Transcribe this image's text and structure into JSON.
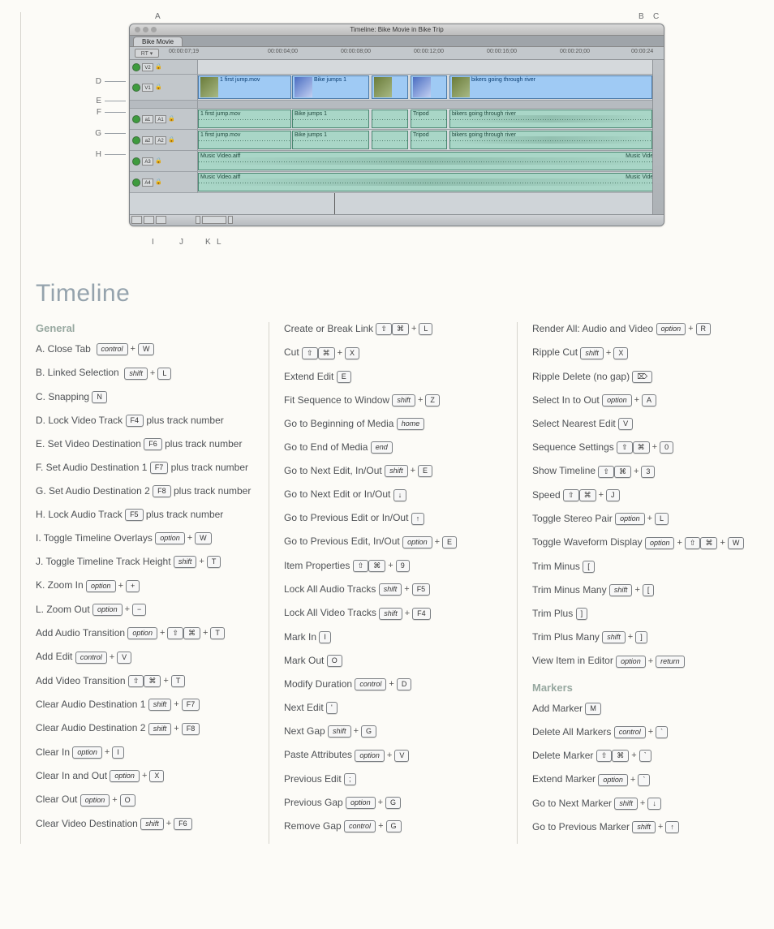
{
  "page_title": "Timeline",
  "screenshot": {
    "window_title": "Timeline: Bike Movie in Bike Trip",
    "tab": "Bike Movie",
    "rt_label": "RT ▾",
    "timecode": "00:00:07;19",
    "ruler_ticks": [
      "00:00:04;00",
      "00:00:08;00",
      "00:00:12;00",
      "00:00:16;00",
      "00:00:20;00",
      "00:00:24"
    ],
    "tracks": {
      "v2": "V2",
      "v1": "V1",
      "a1": "A1",
      "a1dest": "a1",
      "a2": "A2",
      "a2dest": "a2",
      "a3": "A3",
      "a4": "A4"
    },
    "clips": {
      "v1": [
        "1 first jump.mov",
        "Bike jumps 1",
        "bikers going through river"
      ],
      "a1": [
        "1 first jump.mov",
        "Bike jumps 1",
        "Tripod",
        "bikers going through river"
      ],
      "a2": [
        "1 first jump.mov",
        "Bike jumps 1",
        "Tripod",
        "bikers going through river"
      ],
      "a3": "Music Video.aiff",
      "a3r": "Music Video.a",
      "a4": "Music Video.aiff",
      "a4r": "Music Video.a"
    },
    "lock_glyph": "🔒",
    "letters_top": {
      "A": "A",
      "B": "B",
      "C": "C"
    },
    "letters_side": {
      "D": "D",
      "E": "E",
      "F": "F",
      "G": "G",
      "H": "H"
    },
    "letters_bot": {
      "I": "I",
      "J": "J",
      "K": "K",
      "L": "L"
    }
  },
  "sec": {
    "general": "General",
    "markers": "Markers"
  },
  "k": {
    "control": "control",
    "shift": "shift",
    "option": "option",
    "cmd": "⌘",
    "sft": "⇧",
    "W": "W",
    "L": "L",
    "N": "N",
    "F4": "F4",
    "F5": "F5",
    "F6": "F6",
    "F7": "F7",
    "F8": "F8",
    "T": "T",
    "plus": "+",
    "minus": "−",
    "V": "V",
    "I": "I",
    "X": "X",
    "O": "O",
    "E": "E",
    "Z": "Z",
    "home": "home",
    "end": "end",
    "down": "↓",
    "up": "↑",
    "9": "9",
    "G": "G",
    "D": "D",
    "apos": "'",
    "semi": ";",
    "R": "R",
    "del": "⌦",
    "A": "A",
    "0": "0",
    "3": "3",
    "J": "J",
    "lbr": "[",
    "rbr": "]",
    "return": "return",
    "M": "M",
    "tick": "`"
  },
  "plus_txt": " plus track number",
  "c1": {
    "close_tab": "A.  Close Tab",
    "linked_sel": "B.  Linked Selection",
    "snapping": "C.  Snapping",
    "lock_v": "D.  Lock Video Track",
    "set_vdest": "E.  Set Video Destination",
    "set_a1": "F.  Set Audio Destination 1",
    "set_a2": "G.  Set Audio Destination 2",
    "lock_a": "H.  Lock Audio Track",
    "overlays": "I.  Toggle Timeline Overlays",
    "trk_height": "J.  Toggle Timeline Track Height",
    "zoom_in": "K.  Zoom In",
    "zoom_out": "L.  Zoom Out",
    "add_at": "Add Audio Transition",
    "add_edit": "Add Edit",
    "add_vt": "Add Video Transition",
    "clr_a1": "Clear Audio Destination 1",
    "clr_a2": "Clear Audio Destination 2",
    "clr_in": "Clear In",
    "clr_io": "Clear In and Out",
    "clr_out": "Clear Out",
    "clr_vdest": "Clear Video Destination"
  },
  "c2": {
    "link": "Create or Break Link",
    "cut": "Cut",
    "extend": "Extend Edit",
    "fit": "Fit Sequence to Window",
    "gobeg": "Go to Beginning of Media",
    "goend": "Go to End of Media",
    "gonxt_io": "Go to Next Edit, In/Out",
    "gonxt_or": "Go to Next Edit or In/Out",
    "goprev_or": "Go to Previous Edit or In/Out",
    "goprev_io": "Go to Previous Edit, In/Out",
    "item_prop": "Item Properties",
    "lock_all_a": "Lock All Audio Tracks",
    "lock_all_v": "Lock All Video Tracks",
    "mark_in": "Mark In",
    "mark_out": "Mark Out",
    "mod_dur": "Modify Duration",
    "next_edit": "Next Edit",
    "next_gap": "Next Gap",
    "paste_attr": "Paste Attributes",
    "prev_edit": "Previous Edit",
    "prev_gap": "Previous Gap",
    "rem_gap": "Remove Gap"
  },
  "c3": {
    "render_all": "Render All: Audio and Video",
    "rip_cut": "Ripple Cut",
    "rip_del": "Ripple Delete (no gap)",
    "sel_io": "Select In to Out",
    "sel_near": "Select Nearest Edit",
    "seq_set": "Sequence Settings",
    "show_tl": "Show Timeline",
    "speed": "Speed",
    "tog_stereo": "Toggle Stereo Pair",
    "tog_wave": "Toggle Waveform Display",
    "trim_minus": "Trim Minus",
    "trim_minus_m": "Trim Minus Many",
    "trim_plus": "Trim Plus",
    "trim_plus_m": "Trim Plus Many",
    "view_item": "View Item in Editor",
    "add_marker": "Add Marker",
    "del_all_m": "Delete All Markers",
    "del_marker": "Delete Marker",
    "ext_marker": "Extend Marker",
    "go_next_m": "Go to Next Marker",
    "go_prev_m": "Go to Previous Marker"
  }
}
